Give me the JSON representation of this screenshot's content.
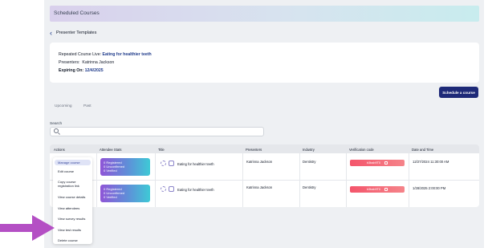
{
  "page": {
    "title": "Scheduled Courses"
  },
  "nav": {
    "back_label": "Presenter Templates"
  },
  "course": {
    "repeated_label": "Repeated Course Live:",
    "repeated_value": "Eating for healthier teeth",
    "presenters_label": "Presenters:",
    "presenters_value": "Katrinna Jackson",
    "expiring_label": "Expiring On:",
    "expiring_value": "12/4/2025"
  },
  "actions": {
    "schedule_label": "Schedule a course"
  },
  "tabs": [
    {
      "label": "Upcoming"
    },
    {
      "label": "Past"
    }
  ],
  "search": {
    "label": "Search",
    "placeholder": ""
  },
  "table": {
    "headers": [
      "Actions",
      "Attendee Stats",
      "Title",
      "Presenters",
      "Industry",
      "Verification code",
      "Date and Time"
    ],
    "rows": [
      {
        "stats": [
          "0 Registered",
          "0 Unconfirmed",
          "0 Verified"
        ],
        "title": "Eating for healthier teeth",
        "presenters": "Katrinna Jackson",
        "industry": "Dentistry",
        "code": "b3bab9T0",
        "datetime": "12/27/2024 11:30:00 AM"
      },
      {
        "stats": [
          "0 Registered",
          "0 Unconfirmed",
          "0 Verified"
        ],
        "title": "Eating for healthier teeth",
        "presenters": "Katrinna Jackson",
        "industry": "Dentistry",
        "code": "b3bab9T0",
        "datetime": "1/28/2025 2:00:00 PM"
      }
    ]
  },
  "menu": {
    "items": [
      {
        "label": "Manage course"
      },
      {
        "label": "Edit course"
      },
      {
        "label": "Copy course registration link"
      },
      {
        "label": "View course details"
      },
      {
        "label": "View attendees"
      },
      {
        "label": "View survey results"
      },
      {
        "label": "View test results"
      },
      {
        "label": "Delete course"
      }
    ]
  },
  "colors": {
    "primary": "#1e2a78",
    "accent_arrow": "#b44fc4",
    "badge": "#f4556b"
  },
  "icons": {
    "back": "chevron-left-icon",
    "search": "search-icon",
    "copy": "copy-icon",
    "pointer": "arrow-right-icon"
  }
}
